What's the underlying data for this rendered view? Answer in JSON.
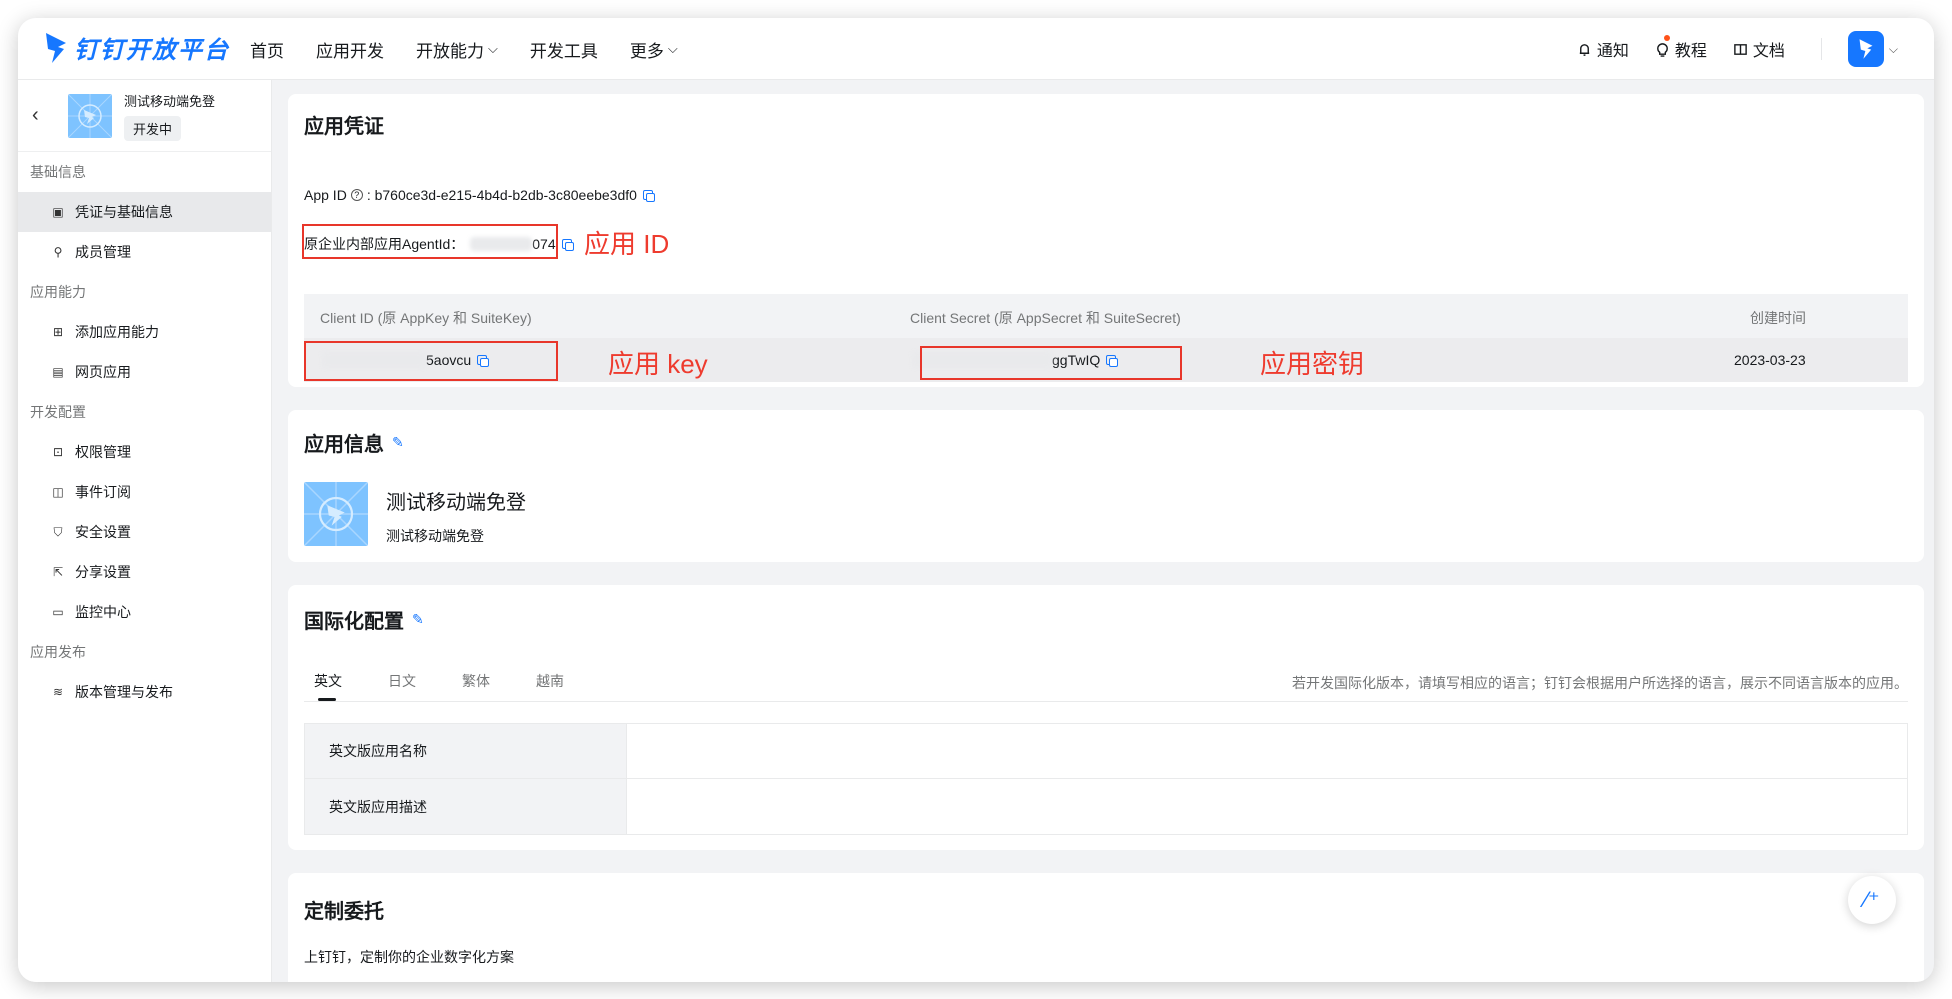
{
  "topbar": {
    "brand": "钉钉开放平台",
    "nav": [
      {
        "label": "首页",
        "dropdown": false
      },
      {
        "label": "应用开发",
        "dropdown": false
      },
      {
        "label": "开放能力",
        "dropdown": true
      },
      {
        "label": "开发工具",
        "dropdown": false
      },
      {
        "label": "更多",
        "dropdown": true
      }
    ],
    "notify": "通知",
    "tutorial": "教程",
    "docs": "文档"
  },
  "sidebar": {
    "app_name": "测试移动端免登",
    "app_status": "开发中",
    "groups": [
      {
        "title": "基础信息",
        "items": [
          {
            "label": "凭证与基础信息",
            "icon": "credential-icon",
            "active": true
          },
          {
            "label": "成员管理",
            "icon": "member-icon",
            "active": false
          }
        ]
      },
      {
        "title": "应用能力",
        "items": [
          {
            "label": "添加应用能力",
            "icon": "add-capability-icon",
            "active": false
          },
          {
            "label": "网页应用",
            "icon": "web-app-icon",
            "active": false
          }
        ]
      },
      {
        "title": "开发配置",
        "items": [
          {
            "label": "权限管理",
            "icon": "permission-icon",
            "active": false
          },
          {
            "label": "事件订阅",
            "icon": "event-icon",
            "active": false
          },
          {
            "label": "安全设置",
            "icon": "security-icon",
            "active": false
          },
          {
            "label": "分享设置",
            "icon": "share-icon",
            "active": false
          },
          {
            "label": "监控中心",
            "icon": "monitor-icon",
            "active": false
          }
        ]
      },
      {
        "title": "应用发布",
        "items": [
          {
            "label": "版本管理与发布",
            "icon": "version-icon",
            "active": false
          }
        ]
      }
    ]
  },
  "credentials": {
    "title": "应用凭证",
    "app_id_label": "App ID",
    "app_id_value": "b760ce3d-e215-4b4d-b2db-3c80eebe3df0",
    "agent_label": "原企业内部应用AgentId：",
    "agent_value_suffix": "074",
    "annot_app_id": "应用 ID",
    "annot_key": "应用 key",
    "annot_secret": "应用密钥",
    "table": {
      "headers": [
        "Client ID (原 AppKey 和 SuiteKey)",
        "Client Secret (原 AppSecret 和 SuiteSecret)",
        "创建时间"
      ],
      "client_id_suffix": "5aovcu",
      "client_secret_suffix": "ggTwIQ",
      "created": "2023-03-23"
    }
  },
  "app_info": {
    "title": "应用信息",
    "name": "测试移动端免登",
    "desc": "测试移动端免登"
  },
  "i18n": {
    "title": "国际化配置",
    "tabs": [
      "英文",
      "日文",
      "繁体",
      "越南"
    ],
    "active_tab": 0,
    "hint": "若开发国际化版本，请填写相应的语言；钉钉会根据用户所选择的语言，展示不同语言版本的应用。",
    "rows": [
      {
        "label": "英文版应用名称",
        "value": ""
      },
      {
        "label": "英文版应用描述",
        "value": ""
      }
    ]
  },
  "custom": {
    "title": "定制委托",
    "desc": "上钉钉，定制你的企业数字化方案"
  },
  "colors": {
    "accent": "#1677ff",
    "annotation": "#ee3b2e"
  }
}
